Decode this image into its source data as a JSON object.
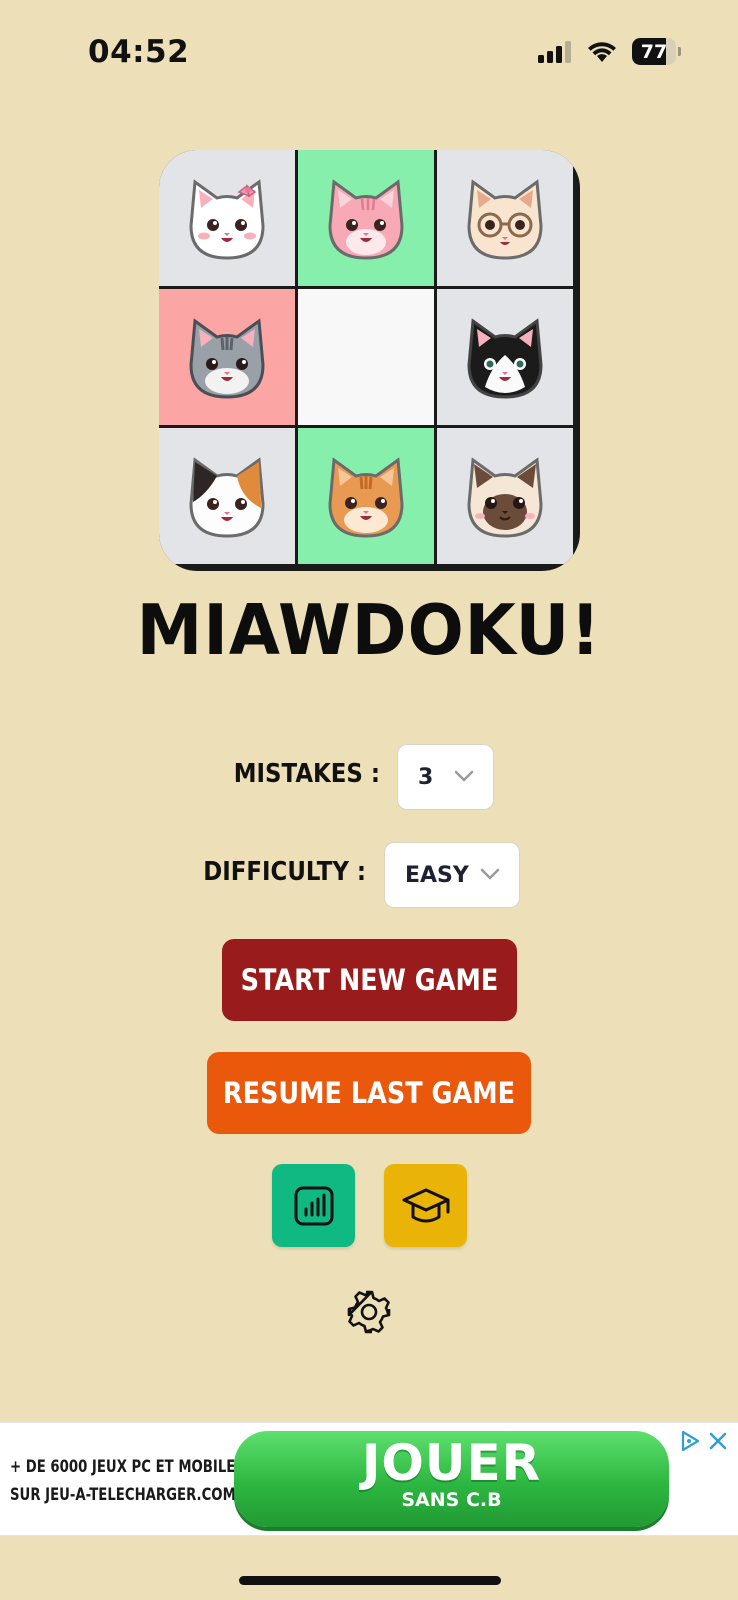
{
  "status_bar": {
    "time": "04:52",
    "battery_level": "77",
    "battery_fraction": 0.77,
    "icons": [
      "cellular-signal-icon",
      "wifi-icon",
      "battery-icon"
    ]
  },
  "board": {
    "cells": [
      {
        "cat": "white-cat-with-bow",
        "bg": "#E3E4E7"
      },
      {
        "cat": "pink-tabby-cat",
        "bg": "#86EFAC"
      },
      {
        "cat": "cream-cat-with-glasses",
        "bg": "#E3E4E7"
      },
      {
        "cat": "gray-tabby-cat",
        "bg": "#FCA5A5"
      },
      {
        "cat": "empty",
        "bg": "#F8F8F8"
      },
      {
        "cat": "tuxedo-cat",
        "bg": "#E3E4E7"
      },
      {
        "cat": "calico-cat",
        "bg": "#E3E4E7"
      },
      {
        "cat": "orange-tabby-cat",
        "bg": "#86EFAC"
      },
      {
        "cat": "siamese-cat",
        "bg": "#E3E4E7"
      }
    ]
  },
  "title": "MIAWDOKU!",
  "options": {
    "mistakes_label": "MISTAKES :",
    "mistakes_value": "3",
    "difficulty_label": "DIFFICULTY :",
    "difficulty_value": "EASY"
  },
  "buttons": {
    "start_new_game": "START NEW GAME",
    "resume_last_game": "RESUME LAST GAME",
    "stats_icon": "bar-chart-icon",
    "learn_icon": "graduation-cap-icon",
    "settings_icon": "gear-icon"
  },
  "colors": {
    "background": "#EDE0B8",
    "start_button": "#991B1B",
    "resume_button": "#EA580C",
    "stats_button": "#10B981",
    "learn_button": "#EAB308"
  },
  "ad": {
    "line1": "+ DE 6000 JEUX PC ET MOBILE",
    "line2": "SUR JEU-A-TELECHARGER.COM",
    "cta_main": "JOUER",
    "cta_sub": "SANS C.B"
  }
}
